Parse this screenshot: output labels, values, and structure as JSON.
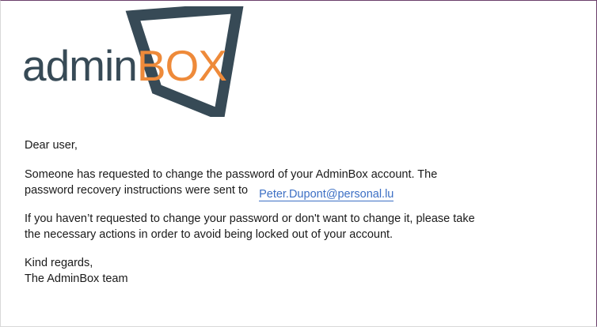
{
  "logo": {
    "text_admin": "admin",
    "text_box": "BOX",
    "colors": {
      "admin": "#374a56",
      "box": "#ee8a3a",
      "frame": "#374a56"
    }
  },
  "email": {
    "greeting": "Dear user,",
    "para1_line1": "Someone has requested to change the password of your AdminBox account. The",
    "para1_line2": "password recovery instructions were sent to",
    "recovery_email": "Peter.Dupont@personal.lu",
    "para2_line1": "If you haven’t requested to change your password or don't want to change it, please take",
    "para2_line2": "the necessary actions in order to avoid being locked out of your account.",
    "closing": "Kind regards,",
    "signature": "The AdminBox team"
  },
  "colors": {
    "link": "#3c6fc4",
    "text": "#1a1a1a"
  }
}
